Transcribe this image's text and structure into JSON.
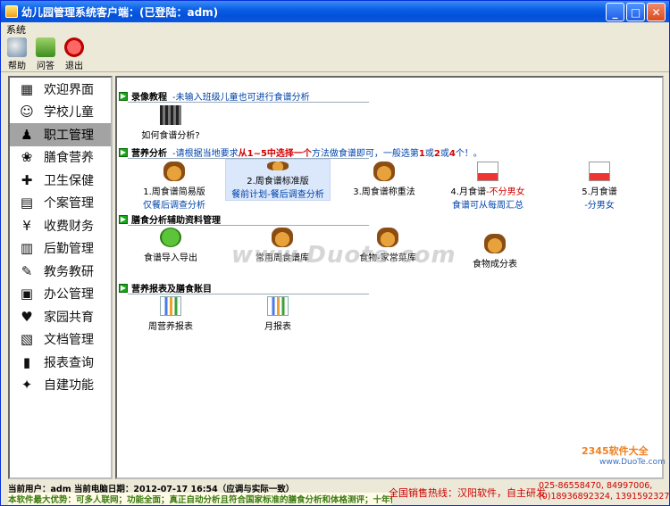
{
  "window": {
    "title": "幼儿园管理系统客户端：(已登陆：adm)"
  },
  "menu": {
    "system": "系统"
  },
  "toolbar": {
    "help": "帮助",
    "qa": "问答",
    "exit": "退出"
  },
  "sidebar": {
    "items": [
      {
        "label": "欢迎界面",
        "icon": "welcome-icon"
      },
      {
        "label": "学校儿童",
        "icon": "children-icon"
      },
      {
        "label": "职工管理",
        "icon": "staff-icon"
      },
      {
        "label": "膳食营养",
        "icon": "nutrition-icon"
      },
      {
        "label": "卫生保健",
        "icon": "health-icon"
      },
      {
        "label": "个案管理",
        "icon": "case-icon"
      },
      {
        "label": "收费财务",
        "icon": "finance-icon"
      },
      {
        "label": "后勤管理",
        "icon": "logistics-icon"
      },
      {
        "label": "教务教研",
        "icon": "teaching-icon"
      },
      {
        "label": "办公管理",
        "icon": "office-icon"
      },
      {
        "label": "家园共育",
        "icon": "family-icon"
      },
      {
        "label": "文档管理",
        "icon": "docs-icon"
      },
      {
        "label": "报表查询",
        "icon": "report-icon"
      },
      {
        "label": "自建功能",
        "icon": "custom-icon"
      }
    ],
    "active": "职工管理"
  },
  "sections": {
    "tutorial": {
      "title": "录像教程",
      "hint": "-未输入班级儿童也可进行食谱分析",
      "item": "如何食谱分析?"
    },
    "nutrition": {
      "title": "营养分析",
      "hint_pre": "-请根据当地要求",
      "hint_red": "从1~5中选择一个",
      "hint_post": "方法做食谱即可，一般选第",
      "hint_n1": "1",
      "hint_or": "或",
      "hint_n2": "2",
      "hint_or2": "或",
      "hint_n3": "4",
      "hint_end": "个！。",
      "items": [
        {
          "line1": "1.周食谱简易版",
          "line2": "仅餐后调查分析"
        },
        {
          "line1": "2.周食谱标准版",
          "line2": "餐前计划-餐后调查分析"
        },
        {
          "line1": "3.周食谱称重法",
          "line2": ""
        },
        {
          "line1": "4.月食谱",
          "line1_red": "-不分男女",
          "line2": "食谱可从每周汇总"
        },
        {
          "line1": "5.月食谱",
          "line2": "-分男女"
        }
      ]
    },
    "aux": {
      "title": "膳食分析辅助资料管理",
      "items": [
        "食谱导入导出",
        "常用周食谱库",
        "食物-家常菜库",
        "食物成分表"
      ]
    },
    "reports": {
      "title": "营养报表及膳食账目",
      "items": [
        "周营养报表",
        "月报表"
      ]
    }
  },
  "watermark": "www.Duote.com",
  "status": {
    "line1": "当前用户：adm  当前电脑日期：2012-07-17  16:54（应调与实际一致）",
    "line2": "本软件最大优势：可多人联网；功能全面；真正自动分析且符合国家标准的膳食分析和体格测评；十年优",
    "hotline": "全国销售热线：汉阳软件，自主研发",
    "phone1": "025-86558470, 84997006,",
    "phone2": "(0)18936892324, 13915923276"
  },
  "logo": {
    "brand": "2345软件大全",
    "sub": "www.DuoTe.com"
  }
}
